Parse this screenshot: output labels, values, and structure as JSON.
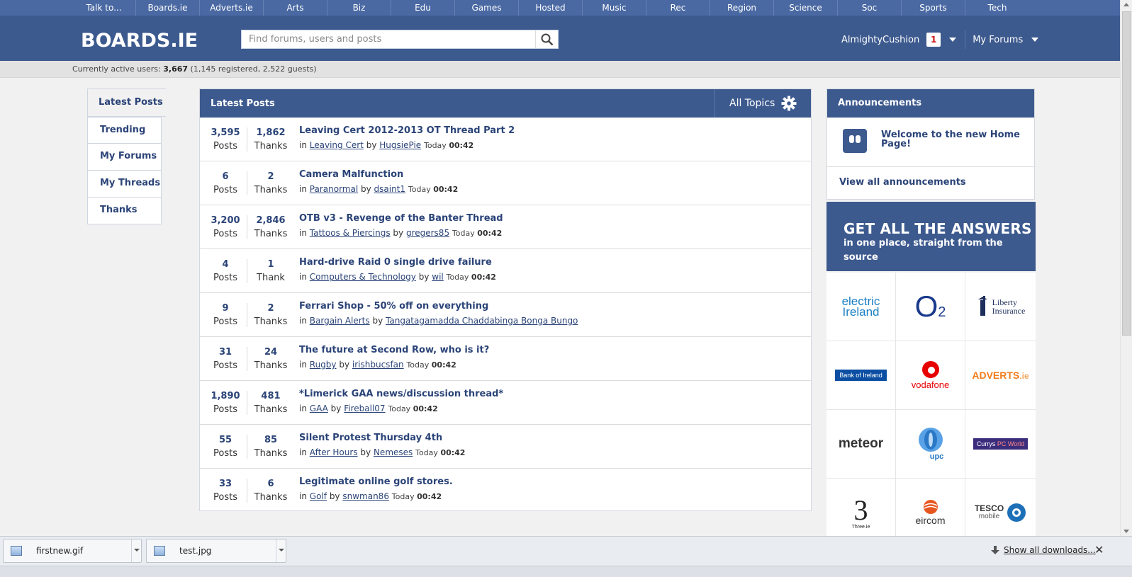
{
  "categories": [
    "Talk to...",
    "Boards.ie",
    "Adverts.ie",
    "Arts",
    "Biz",
    "Edu",
    "Games",
    "Hosted",
    "Music",
    "Rec",
    "Region",
    "Science",
    "Soc",
    "Sports",
    "Tech"
  ],
  "header": {
    "logo": "BOARDS.IE",
    "search_placeholder": "Find forums, users and posts",
    "username": "AlmightyCushion",
    "notification_count": "1",
    "my_forums": "My Forums"
  },
  "active_users": {
    "prefix": "Currently active users:",
    "total": "3,667",
    "detail": "(1,145 registered, 2,522 guests)"
  },
  "left_tabs": [
    "Latest Posts",
    "Trending",
    "My Forums",
    "My Threads",
    "Thanks"
  ],
  "latest": {
    "title": "Latest Posts",
    "topics_label": "All Topics",
    "posts": [
      {
        "posts": "3,595",
        "posts_label": "Posts",
        "thanks": "1,862",
        "thanks_label": "Thanks",
        "title": "Leaving Cert 2012-2013 OT Thread Part 2",
        "forum": "Leaving Cert",
        "user": "HugsiePie",
        "day": "Today",
        "time": "00:42"
      },
      {
        "posts": "6",
        "posts_label": "Posts",
        "thanks": "2",
        "thanks_label": "Thanks",
        "title": "Camera Malfunction",
        "forum": "Paranormal",
        "user": "dsaint1",
        "day": "Today",
        "time": "00:42"
      },
      {
        "posts": "3,200",
        "posts_label": "Posts",
        "thanks": "2,846",
        "thanks_label": "Thanks",
        "title": "OTB v3 - Revenge of the Banter Thread",
        "forum": "Tattoos & Piercings",
        "user": "gregers85",
        "day": "Today",
        "time": "00:42"
      },
      {
        "posts": "4",
        "posts_label": "Posts",
        "thanks": "1",
        "thanks_label": "Thank",
        "title": "Hard-drive Raid 0 single drive failure",
        "forum": "Computers & Technology",
        "user": "wil",
        "day": "Today",
        "time": "00:42"
      },
      {
        "posts": "9",
        "posts_label": "Posts",
        "thanks": "2",
        "thanks_label": "Thanks",
        "title": "Ferrari Shop - 50% off on everything",
        "forum": "Bargain Alerts",
        "user": "Tangatagamadda Chaddabinga Bonga Bungo",
        "day": "",
        "time": ""
      },
      {
        "posts": "31",
        "posts_label": "Posts",
        "thanks": "24",
        "thanks_label": "Thanks",
        "title": "The future at Second Row, who is it?",
        "forum": "Rugby",
        "user": "irishbucsfan",
        "day": "Today",
        "time": "00:42"
      },
      {
        "posts": "1,890",
        "posts_label": "Posts",
        "thanks": "481",
        "thanks_label": "Thanks",
        "title": "*Limerick GAA news/discussion thread*",
        "forum": "GAA",
        "user": "Fireball07",
        "day": "Today",
        "time": "00:42"
      },
      {
        "posts": "55",
        "posts_label": "Posts",
        "thanks": "85",
        "thanks_label": "Thanks",
        "title": "Silent Protest Thursday 4th",
        "forum": "After Hours",
        "user": "Nemeses",
        "day": "Today",
        "time": "00:42"
      },
      {
        "posts": "33",
        "posts_label": "Posts",
        "thanks": "6",
        "thanks_label": "Thanks",
        "title": "Legitimate online golf stores.",
        "forum": "Golf",
        "user": "snwman86",
        "day": "Today",
        "time": "00:42"
      }
    ],
    "in_label": "in",
    "by_label": "by"
  },
  "announcements": {
    "title": "Announcements",
    "item": "Welcome to the new Home Page!",
    "view_all": "View all announcements"
  },
  "promo": {
    "headline": "GET ALL THE ANSWERS",
    "subline": "in one place, straight from the source"
  },
  "brands": [
    {
      "name": "electric ireland",
      "icon": "electric-ireland-logo",
      "line1": "electric",
      "line2": "Ireland",
      "color": "#1a7fc4"
    },
    {
      "name": "O2",
      "icon": "o2-logo",
      "line1": "O",
      "line2": "2",
      "color": "#1a3a8c"
    },
    {
      "name": "Liberty Insurance",
      "icon": "liberty-insurance-logo",
      "line1": "Liberty",
      "line2": "Insurance",
      "color": "#1f2f5c"
    },
    {
      "name": "Bank of Ireland",
      "icon": "bank-of-ireland-logo",
      "line1": "Bank of Ireland",
      "line2": "",
      "color": "#0b4ea2"
    },
    {
      "name": "vodafone",
      "icon": "vodafone-logo",
      "line1": "vodafone",
      "line2": "",
      "color": "#e60000"
    },
    {
      "name": "ADVERTS.ie",
      "icon": "adverts-logo",
      "line1": "ADVERTS",
      "line2": ".ie",
      "color": "#f07c1a"
    },
    {
      "name": "meteor",
      "icon": "meteor-logo",
      "line1": "meteor",
      "line2": "",
      "color": "#333333"
    },
    {
      "name": "upc",
      "icon": "upc-logo",
      "line1": "upc",
      "line2": "",
      "color": "#2a78c6"
    },
    {
      "name": "Currys PC World",
      "icon": "currys-logo",
      "line1": "Currys",
      "line2": "PC World",
      "color": "#3b2d7c"
    },
    {
      "name": "Three.ie",
      "icon": "three-logo",
      "line1": "Three.ie",
      "line2": "",
      "color": "#222222"
    },
    {
      "name": "eircom",
      "icon": "eircom-logo",
      "line1": "eircom",
      "line2": "",
      "color": "#e8561f"
    },
    {
      "name": "TESCO mobile",
      "icon": "tesco-mobile-logo",
      "line1": "TESCO",
      "line2": "mobile",
      "color": "#1d70b8"
    }
  ],
  "downloads": {
    "items": [
      "firstnew.gif",
      "test.jpg"
    ],
    "show_all": "Show all downloads..."
  }
}
